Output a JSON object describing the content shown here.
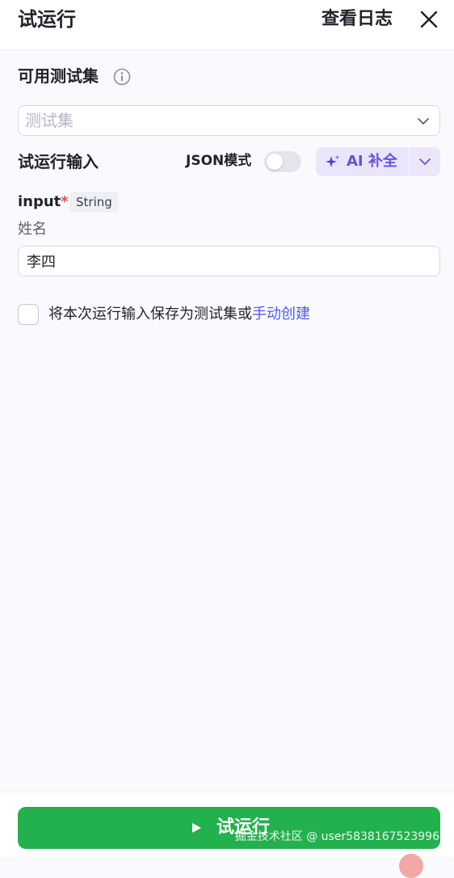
{
  "header": {
    "title": "试运行",
    "view_log": "查看日志"
  },
  "dataset": {
    "label": "可用测试集",
    "placeholder": "测试集"
  },
  "run_input": {
    "label": "试运行输入",
    "json_mode_label": "JSON模式",
    "json_mode_on": false,
    "ai_complete_label": "AI 补全"
  },
  "field": {
    "name": "input",
    "required_mark": "*",
    "type": "String",
    "description": "姓名",
    "value": "李四"
  },
  "save": {
    "checked": false,
    "text": "将本次运行输入保存为测试集或",
    "link": "手动创建"
  },
  "footer": {
    "run_label": "试运行",
    "watermark": "掘金技术社区 @ user5838167523996"
  },
  "colors": {
    "primary_green": "#22b14c",
    "ai_purple": "#6b4fd8",
    "link_blue": "#4e5be8"
  }
}
